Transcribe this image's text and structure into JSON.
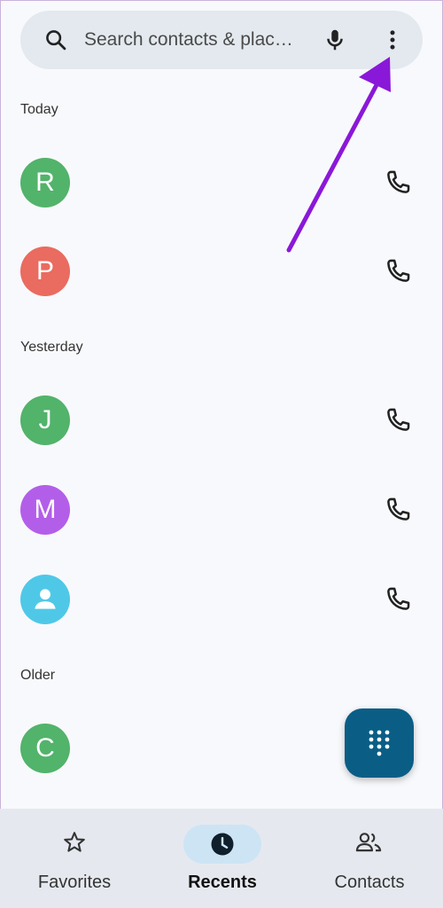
{
  "search": {
    "placeholder": "Search contacts & plac…"
  },
  "sections": [
    {
      "label": "Today"
    },
    {
      "label": "Yesterday"
    },
    {
      "label": "Older"
    }
  ],
  "contacts": [
    {
      "initial": "R",
      "color": "#52b36b"
    },
    {
      "initial": "P",
      "color": "#ea6b60"
    },
    {
      "initial": "J",
      "color": "#52b36b"
    },
    {
      "initial": "M",
      "color": "#b35ee9"
    },
    {
      "initial": "",
      "color": "#4fc8e8",
      "icon": "person-icon"
    },
    {
      "initial": "C",
      "color": "#52b36b"
    }
  ],
  "nav": {
    "favorites": "Favorites",
    "recents": "Recents",
    "contacts": "Contacts"
  },
  "colors": {
    "accent": "#0a5e86",
    "annotation_arrow": "#8a18d8"
  }
}
